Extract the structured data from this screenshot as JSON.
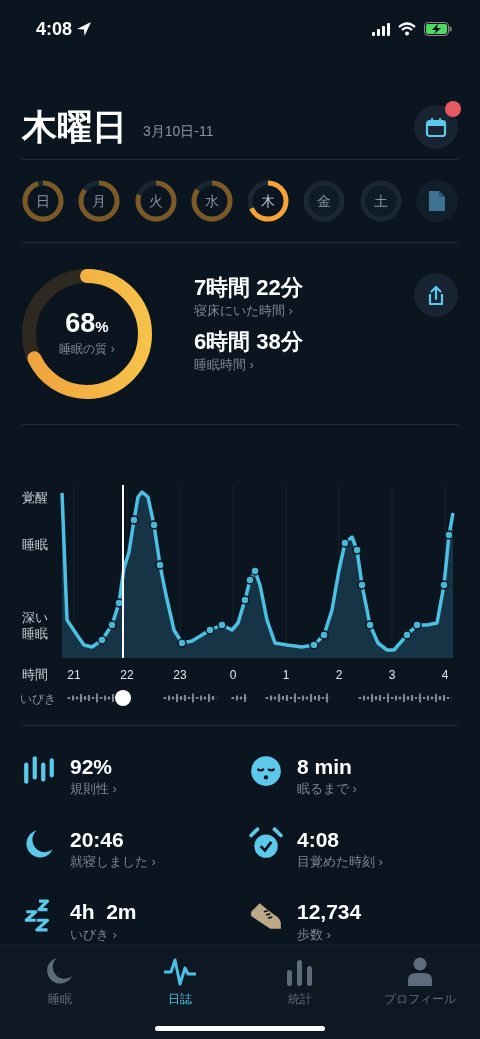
{
  "status_bar": {
    "time": "4:08"
  },
  "header": {
    "title": "木曜日",
    "date_range": "3月10日-11",
    "calendar_badge": true
  },
  "days": [
    {
      "label": "日",
      "tracked": true,
      "selected": false
    },
    {
      "label": "月",
      "tracked": true,
      "selected": false
    },
    {
      "label": "火",
      "tracked": true,
      "selected": false
    },
    {
      "label": "水",
      "tracked": true,
      "selected": false
    },
    {
      "label": "木",
      "tracked": true,
      "selected": true
    },
    {
      "label": "金",
      "tracked": false,
      "selected": false
    },
    {
      "label": "土",
      "tracked": false,
      "selected": false
    }
  ],
  "summary": {
    "quality": {
      "value": "68",
      "unit": "%",
      "label": "睡眠の質 ›"
    },
    "metrics": [
      {
        "value": "7時間 22分",
        "label": "寝床にいた時間 ›"
      },
      {
        "value": "6時間 38分",
        "label": "睡眠時間 ›"
      }
    ]
  },
  "chart": {
    "y_labels": [
      "覚醒",
      "睡眠",
      "深い睡眠"
    ],
    "x_title": "時間",
    "x_labels": [
      "21",
      "22",
      "23",
      "0",
      "1",
      "2",
      "3",
      "4"
    ],
    "snore_label": "いびき"
  },
  "stats": [
    {
      "kind": "regularity",
      "value": "92%",
      "label": "規則性 ›"
    },
    {
      "kind": "fall-asleep",
      "value": "8 min",
      "label": "眠るまで ›"
    },
    {
      "kind": "bedtime",
      "value": "20:46",
      "label": "就寝しました ›"
    },
    {
      "kind": "wake",
      "value": "4:08",
      "label": "目覚めた時刻 ›"
    },
    {
      "kind": "snore",
      "value": "4h  2m",
      "label": "いびき ›"
    },
    {
      "kind": "steps",
      "value": "12,734",
      "label": "歩数 ›"
    }
  ],
  "tabs": [
    {
      "kind": "sleep",
      "label": "睡眠",
      "selected": false
    },
    {
      "kind": "journal",
      "label": "日誌",
      "selected": true
    },
    {
      "kind": "stats",
      "label": "統計",
      "selected": false
    },
    {
      "kind": "profile",
      "label": "プロフィール",
      "selected": false
    }
  ]
}
